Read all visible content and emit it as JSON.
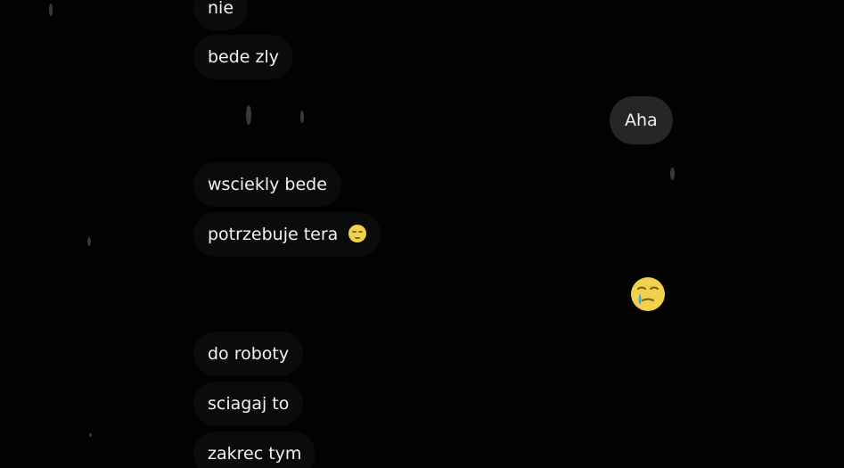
{
  "chat": {
    "messages": [
      {
        "direction": "incoming",
        "text": "nie"
      },
      {
        "direction": "incoming",
        "text": "bede zly"
      },
      {
        "direction": "outgoing",
        "text": "Aha"
      },
      {
        "direction": "incoming",
        "text": "wsciekly bede"
      },
      {
        "direction": "incoming",
        "text": "potrzebuje tera",
        "emoji": "sleepy-face-icon"
      },
      {
        "direction": "outgoing",
        "emoji": "face-holding-back-tears-icon"
      },
      {
        "direction": "incoming",
        "text": "do roboty"
      },
      {
        "direction": "incoming",
        "text": "sciagaj to"
      },
      {
        "direction": "incoming",
        "text": "zakrec tym"
      }
    ]
  },
  "colors": {
    "background": "#020202",
    "incoming_bubble": "#0b0b0b",
    "outgoing_bubble": "#262626",
    "text": "#f2f2f2",
    "emoji_yellow": "#f0d24c"
  }
}
